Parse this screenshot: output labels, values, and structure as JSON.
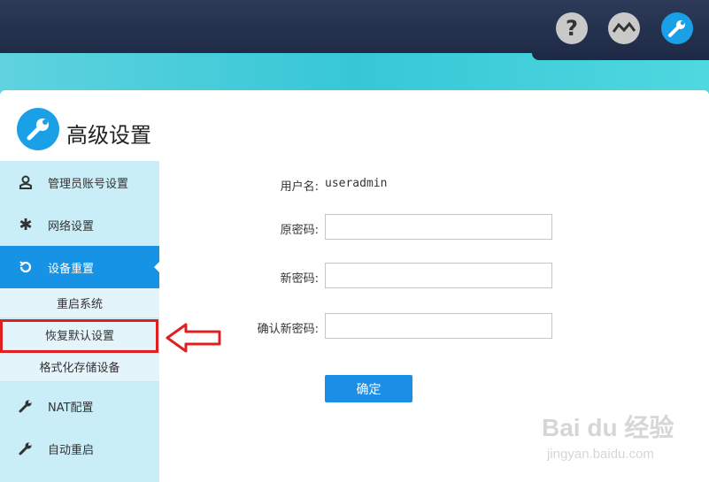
{
  "header": {
    "icons": [
      "help-icon",
      "chart-icon",
      "settings-wrench-icon"
    ]
  },
  "page": {
    "title": "高级设置"
  },
  "sidebar": {
    "items": [
      {
        "label": "管理员账号设置",
        "icon": "user-icon"
      },
      {
        "label": "网络设置",
        "icon": "gear-icon"
      },
      {
        "label": "设备重置",
        "icon": "reset-icon",
        "active": true
      },
      {
        "label": "NAT配置",
        "icon": "wrench-icon"
      },
      {
        "label": "自动重启",
        "icon": "wrench-icon"
      }
    ],
    "sub_items": [
      {
        "label": "重启系统"
      },
      {
        "label": "恢复默认设置"
      },
      {
        "label": "格式化存储设备"
      }
    ]
  },
  "form": {
    "username_label": "用户名:",
    "username_value": "useradmin",
    "old_password_label": "原密码:",
    "new_password_label": "新密码:",
    "confirm_password_label": "确认新密码:",
    "old_password_value": "",
    "new_password_value": "",
    "confirm_password_value": "",
    "submit_label": "确定"
  },
  "watermark": {
    "brand": "Bai du 经验",
    "url": "jingyan.baidu.com"
  },
  "colors": {
    "accent": "#1793e6",
    "sidebar_bg": "#c9eef8",
    "highlight": "#e02020"
  }
}
